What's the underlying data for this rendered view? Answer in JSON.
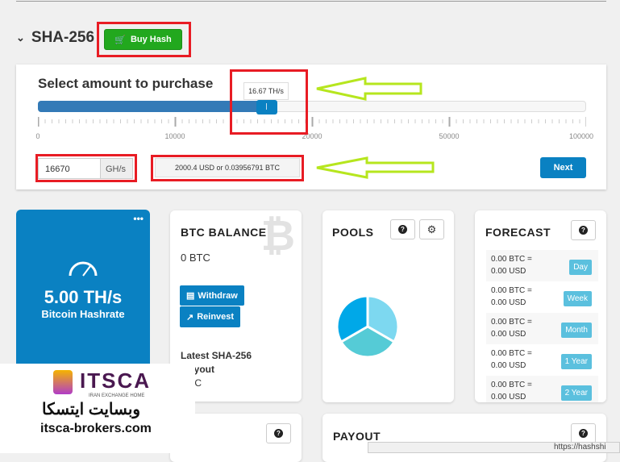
{
  "section": {
    "title": "SHA-256",
    "buy_label": "Buy Hash"
  },
  "purchase": {
    "title": "Select amount to purchase",
    "tooltip": "16.67 TH/s",
    "slider_percent": 16.67,
    "scale_labels": [
      "0",
      "10000",
      "20000",
      "50000",
      "100000"
    ],
    "amount_value": "16670",
    "amount_unit": "GH/s",
    "price": "2000.4 USD or 0.03956791 BTC",
    "next_label": "Next"
  },
  "hashrate": {
    "value": "5.00 TH/s",
    "label": "Bitcoin Hashrate"
  },
  "balance": {
    "title": "BTC BALANCE",
    "value": "0 BTC",
    "withdraw": "Withdraw",
    "reinvest": "Reinvest",
    "latest": "Latest SHA-256",
    "latest2": "ayout",
    "latest3": "TC"
  },
  "pools": {
    "title": "POOLS",
    "colors": [
      "#7dd8f0",
      "#55cbd6",
      "#00a8e8"
    ]
  },
  "forecast": {
    "title": "FORECAST",
    "rows": [
      {
        "btc": "0.00 BTC =",
        "usd": "0.00 USD",
        "period": "Day"
      },
      {
        "btc": "0.00 BTC =",
        "usd": "0.00 USD",
        "period": "Week"
      },
      {
        "btc": "0.00 BTC =",
        "usd": "0.00 USD",
        "period": "Month"
      },
      {
        "btc": "0.00 BTC =",
        "usd": "0.00 USD",
        "period": "1 Year"
      },
      {
        "btc": "0.00 BTC =",
        "usd": "0.00 USD",
        "period": "2 Year"
      }
    ]
  },
  "payout": {
    "title": "PAYOUT"
  },
  "watermark": {
    "brand": "ITSCA",
    "tagline": "IRAN EXCHANGE HOME",
    "persian": "وبسایت ایتسکا",
    "site": "itsca-brokers.com"
  },
  "status_url": "https://hashshi"
}
